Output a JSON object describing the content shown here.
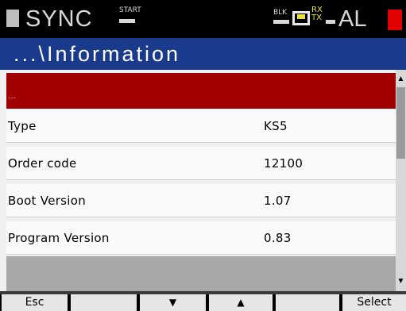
{
  "status_bar": {
    "sync": "SYNC",
    "start": "START",
    "blk": "BLK",
    "rx": "RX",
    "tx": "TX",
    "al": "AL",
    "alarm_color": "#e00000"
  },
  "title": "...\\Information",
  "list": {
    "header": "...",
    "rows": [
      {
        "label": "Type",
        "value": "KS5"
      },
      {
        "label": "Order code",
        "value": "12100"
      },
      {
        "label": "Boot Version",
        "value": "1.07"
      },
      {
        "label": "Program Version",
        "value": "0.83"
      }
    ]
  },
  "scrollbar": {
    "up_icon": "arrow-up-icon",
    "down_icon": "arrow-down-icon"
  },
  "softkeys": [
    "Esc",
    "",
    "▼",
    "▲",
    "",
    "Select"
  ],
  "colors": {
    "title_bar": "#1a3a8c",
    "header_row": "#a00000",
    "status_bar": "#000000"
  }
}
